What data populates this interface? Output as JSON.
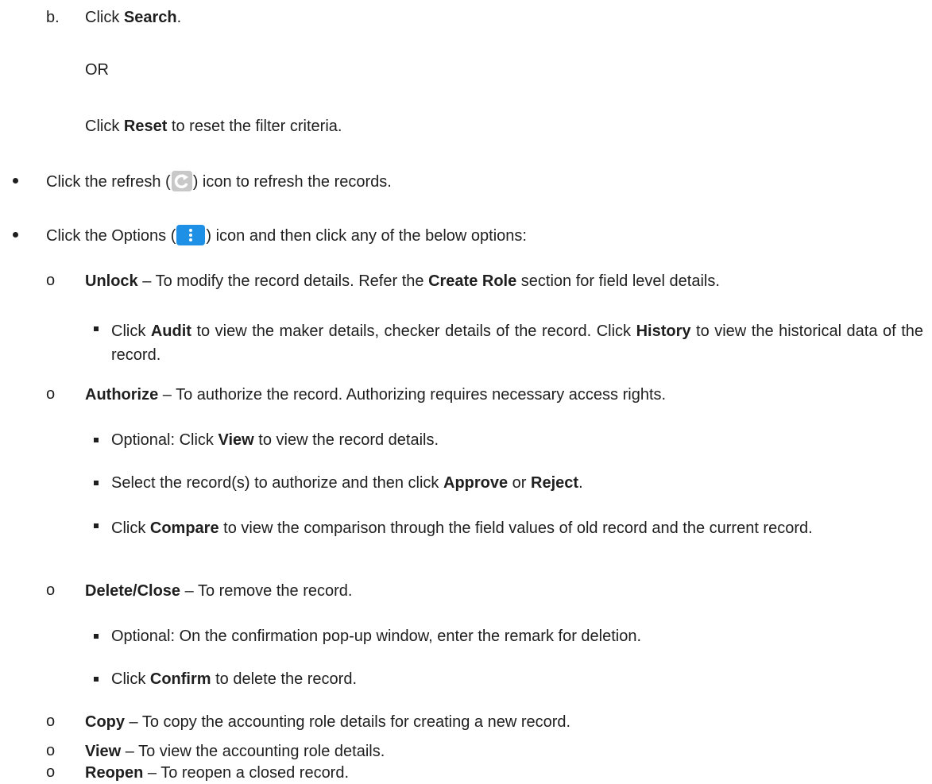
{
  "step_b": {
    "marker": "b.",
    "pre": "Click ",
    "bold": "Search",
    "post": "."
  },
  "or_text": "OR",
  "reset": {
    "pre": "Click ",
    "bold": "Reset",
    "post": " to reset the filter criteria."
  },
  "refresh": {
    "pre": "Click the refresh (",
    "post": ") icon to refresh the records.",
    "icon": "refresh-icon"
  },
  "options": {
    "pre": "Click the Options (",
    "post": ") icon and then click any of the below options:",
    "icon": "more-vertical-icon"
  },
  "unlock": {
    "bold": "Unlock",
    "text": " – To modify the record details. Refer the ",
    "bold2": "Create Role",
    "text2": " section for field level details."
  },
  "audit": {
    "pre": "Click ",
    "bold": "Audit",
    "mid": " to view the maker details, checker details of the record. Click ",
    "bold2": "History",
    "post": " to view the historical data of the record."
  },
  "authorize": {
    "bold": "Authorize",
    "text": " – To authorize the record. Authorizing requires necessary access rights."
  },
  "auth_view": {
    "pre": "Optional: Click ",
    "bold": "View",
    "post": " to view the record details."
  },
  "auth_select": {
    "pre": "Select the record(s) to authorize and then click ",
    "bold": "Approve",
    "mid": " or ",
    "bold2": "Reject",
    "post": "."
  },
  "auth_compare": {
    "pre": "Click ",
    "bold": "Compare",
    "post": " to view the comparison through the field values of old record and the current record."
  },
  "delete": {
    "bold": "Delete/Close",
    "text": " – To remove the record."
  },
  "delete_remark": {
    "text": "Optional: On the confirmation pop-up window, enter the remark for deletion."
  },
  "delete_confirm": {
    "pre": "Click ",
    "bold": "Confirm",
    "post": " to delete the record."
  },
  "copy": {
    "bold": "Copy",
    "text": " – To copy the accounting role details for creating a new record."
  },
  "view": {
    "bold": "View",
    "text": " – To view the accounting role details."
  },
  "reopen": {
    "bold": "Reopen",
    "text": " – To reopen a closed record."
  }
}
